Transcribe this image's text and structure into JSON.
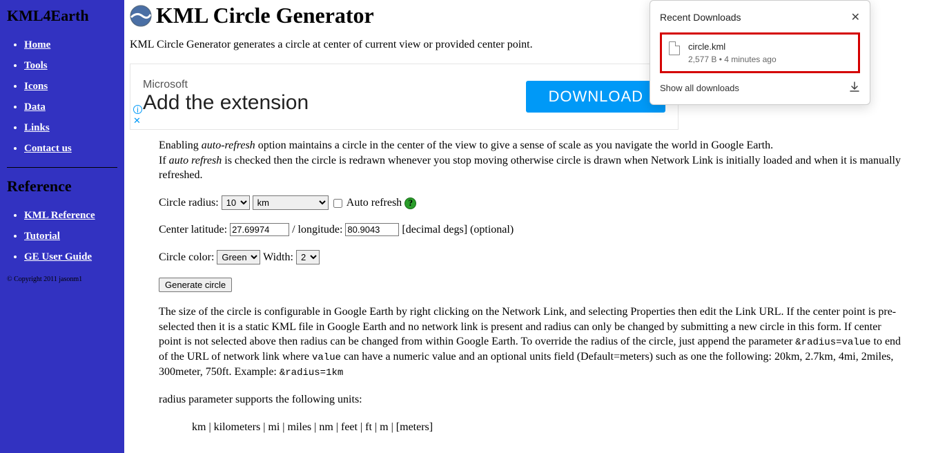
{
  "sidebar": {
    "title": "KML4Earth",
    "nav": [
      "Home",
      "Tools",
      "Icons",
      "Data",
      "Links",
      "Contact us"
    ],
    "ref_title": "Reference",
    "refs": [
      "KML Reference",
      "Tutorial",
      "GE User Guide"
    ],
    "copyright": "© Copyright 2011 jasonm1"
  },
  "page": {
    "title": "KML Circle Generator",
    "subtitle": "KML Circle Generator generates a circle at center of current view or provided center point."
  },
  "ad": {
    "brand": "Microsoft",
    "headline": "Add the extension",
    "cta": "DOWNLOAD"
  },
  "intro": {
    "p1a": "Enabling ",
    "p1b": "auto-refresh",
    "p1c": " option maintains a circle in the center of the view to give a sense of scale as you navigate the world in Google Earth.",
    "p2a": "If ",
    "p2b": "auto refresh",
    "p2c": " is checked then the circle is redrawn whenever you stop moving otherwise circle is drawn when Network Link is initially loaded and when it is manually refreshed."
  },
  "form": {
    "radius_label": "Circle radius:",
    "radius_value": "10",
    "radius_unit": "km",
    "auto_refresh_label": " Auto refresh ",
    "auto_refresh_checked": false,
    "lat_label": "Center latitude:",
    "lat_value": "27.69974",
    "lon_label": "longitude:",
    "lon_value": "80.9043",
    "coord_hint": "[decimal degs] (optional)",
    "color_label": "Circle color:",
    "color_value": "Green",
    "width_label": "Width:",
    "width_value": "2",
    "generate": "Generate circle"
  },
  "desc": {
    "p1a": "The size of the circle is configurable in Google Earth by right clicking on the Network Link, and selecting Properties then edit the Link URL. If the center point is pre-selected then it is a static KML file in Google Earth and no network link is present and radius can only be changed by submitting a new circle in this form. If center point is not selected above then radius can be changed from within Google Earth. To override the radius of the circle, just append the parameter ",
    "code1": "&radius=value",
    "p1b": " to end of the URL of network link where ",
    "code2": "value",
    "p1c": " can have a numeric value and an optional units field (Default=meters) such as one the following: 20km, 2.7km, 4mi, 2miles, 300meter, 750ft. Example: ",
    "code3": "&radius=1km",
    "p2": "radius parameter supports the following units:",
    "units": "km | kilometers | mi | miles | nm | feet | ft | m | [meters]"
  },
  "downloads": {
    "header": "Recent Downloads",
    "file_name": "circle.kml",
    "file_meta": "2,577 B • 4 minutes ago",
    "show_all": "Show all downloads"
  }
}
